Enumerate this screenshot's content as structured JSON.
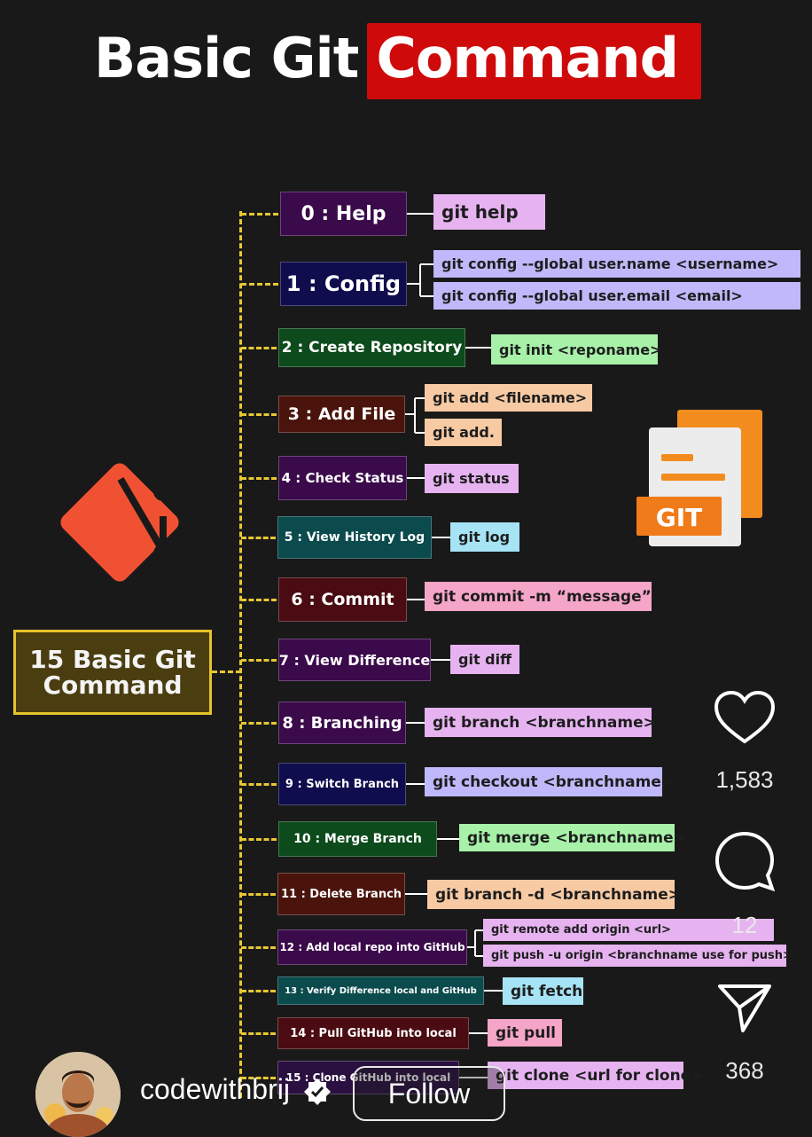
{
  "title": {
    "part1": "Basic Git",
    "part2": "Command"
  },
  "root_label": {
    "line1": "15 Basic Git",
    "line2": "Command"
  },
  "items": [
    {
      "label": "0 : Help",
      "cmds": [
        "git help"
      ]
    },
    {
      "label": "1 : Config",
      "cmds": [
        "git config --global user.name <username>",
        "git config --global user.email <email>"
      ]
    },
    {
      "label": "2 : Create Repository",
      "cmds": [
        "git init <reponame>"
      ]
    },
    {
      "label": "3 : Add File",
      "cmds": [
        "git add <filename>",
        "git add."
      ]
    },
    {
      "label": "4 : Check Status",
      "cmds": [
        "git status"
      ]
    },
    {
      "label": "5 : View History Log",
      "cmds": [
        "git log"
      ]
    },
    {
      "label": "6 : Commit",
      "cmds": [
        "git commit -m “message”"
      ]
    },
    {
      "label": "7 : View Difference",
      "cmds": [
        "git diff"
      ]
    },
    {
      "label": "8 : Branching",
      "cmds": [
        "git branch <branchname>"
      ]
    },
    {
      "label": "9 : Switch Branch",
      "cmds": [
        "git checkout <branchname>"
      ]
    },
    {
      "label": "10 : Merge Branch",
      "cmds": [
        "git merge <branchname>"
      ]
    },
    {
      "label": "11 : Delete Branch",
      "cmds": [
        "git branch -d <branchname>"
      ]
    },
    {
      "label": "12 : Add local repo into GitHub",
      "cmds": [
        "git remote add origin <url>",
        "git push -u origin <branchname use for push>"
      ]
    },
    {
      "label": "13 : Verify Difference local and GitHub",
      "cmds": [
        "git fetch"
      ]
    },
    {
      "label": "14 : Pull GitHub into local",
      "cmds": [
        "git pull"
      ]
    },
    {
      "label": "15 : Clone GitHub into local",
      "cmds": [
        "git clone <url for clone>"
      ]
    }
  ],
  "git_file_icon_text": "GIT",
  "actions": {
    "likes": "1,583",
    "comments": "12",
    "shares": "368"
  },
  "author": {
    "username": "codewithbrij",
    "follow_label": "Follow"
  },
  "colors": {
    "background": "#191919",
    "title_highlight": "#cf0a0a",
    "connector": "#e7c832",
    "git_logo": "#f05133"
  }
}
